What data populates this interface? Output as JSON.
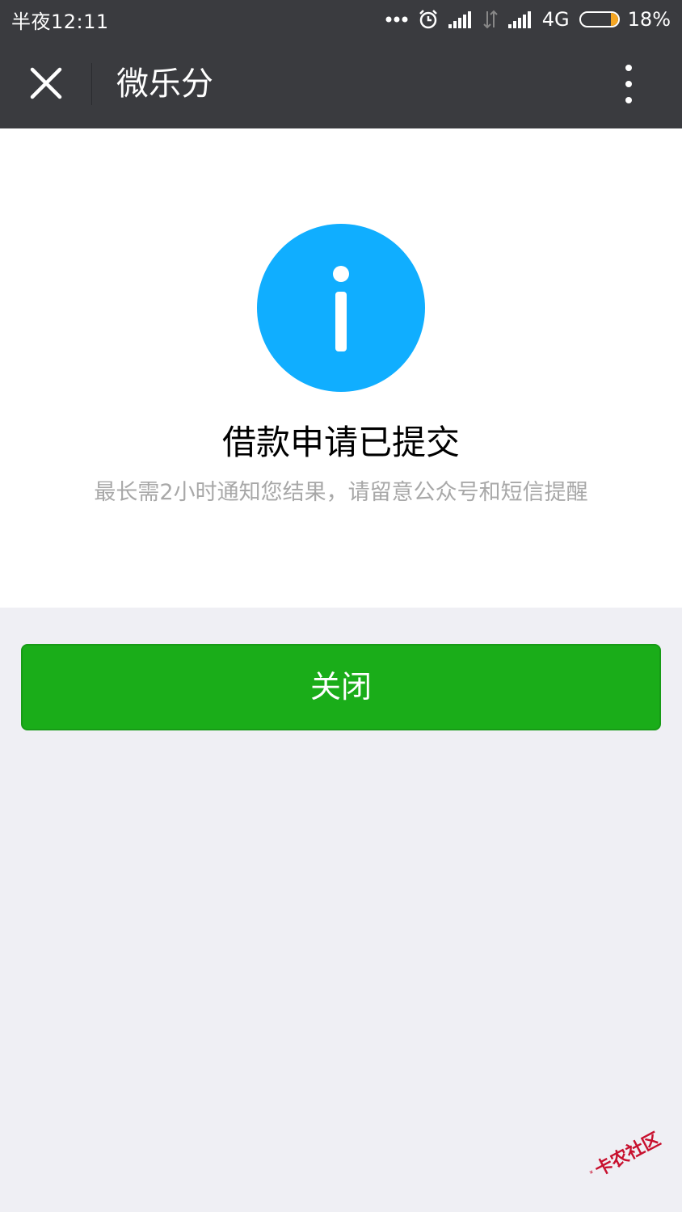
{
  "status_bar": {
    "time": "半夜12:11",
    "network": "4G",
    "battery_percent": "18%",
    "battery_level": 0.18,
    "icons": [
      "more-dots-icon",
      "alarm-icon",
      "signal-icon",
      "data-transfer-icon",
      "signal-icon",
      "battery-icon"
    ]
  },
  "nav": {
    "title": "微乐分",
    "close_icon": "close-icon",
    "more_icon": "more-vertical-icon"
  },
  "result": {
    "icon": "info-icon",
    "title": "借款申请已提交",
    "description": "最长需2小时通知您结果，请留意公众号和短信提醒"
  },
  "actions": {
    "close_label": "关闭"
  },
  "watermark": {
    "text": "卡农社区"
  },
  "colors": {
    "bar_background": "#3a3b3f",
    "info_blue": "#10aeff",
    "primary_green": "#1aad19",
    "page_background": "#efeff4",
    "description_gray": "#a8a8a8"
  }
}
